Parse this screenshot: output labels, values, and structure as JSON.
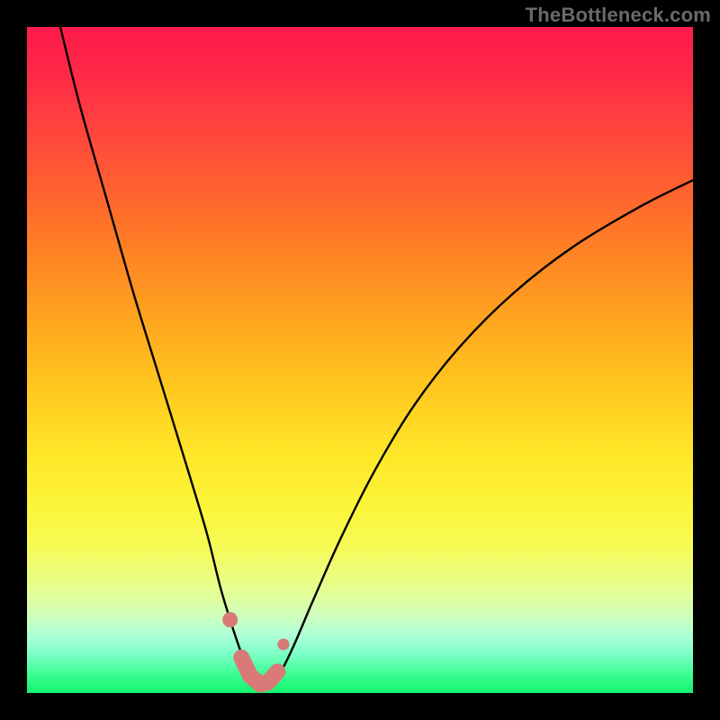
{
  "watermark": "TheBottleneck.com",
  "colors": {
    "frame": "#000000",
    "curve": "#000000",
    "marker_fill": "#d97a78",
    "marker_stroke": "#d97a78"
  },
  "chart_data": {
    "type": "line",
    "title": "",
    "xlabel": "",
    "ylabel": "",
    "xlim": [
      0,
      100
    ],
    "ylim": [
      0,
      100
    ],
    "grid": false,
    "legend": false,
    "series": [
      {
        "name": "bottleneck-curve",
        "x": [
          5,
          8,
          12,
          16,
          20,
          24,
          27,
          29,
          30.5,
          32,
          33.5,
          35,
          36.5,
          38,
          40,
          43,
          47,
          52,
          58,
          65,
          73,
          82,
          92,
          100
        ],
        "y": [
          100,
          88,
          74,
          60,
          47,
          34,
          24,
          16,
          11,
          6.5,
          3,
          1.2,
          1.2,
          3,
          7,
          14,
          23,
          33,
          43,
          52,
          60,
          67,
          73,
          77
        ]
      }
    ],
    "markers": {
      "name": "highlight-points",
      "x": [
        30.5,
        32.2,
        33.5,
        35,
        36.2,
        37.6,
        38.5
      ],
      "y": [
        11,
        5.3,
        2.6,
        1.3,
        1.6,
        3.2,
        7.3
      ]
    }
  }
}
